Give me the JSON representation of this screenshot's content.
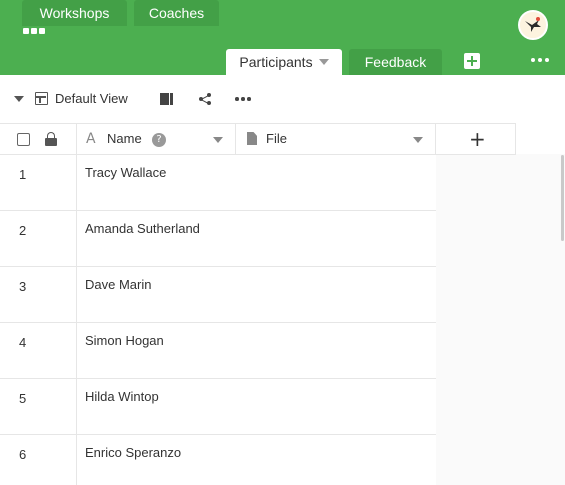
{
  "header": {
    "tabs": [
      {
        "label": "Workshops",
        "active": false
      },
      {
        "label": "Coaches",
        "active": false
      },
      {
        "label": "Participants",
        "active": true
      },
      {
        "label": "Feedback",
        "active": false
      }
    ],
    "add_tab_icon": "plus-square-icon",
    "more_icon": "more-horizontal-icon",
    "apps_icon": "apps-grid-icon",
    "avatar_icon": "user-avatar-icon"
  },
  "toolbar": {
    "view_name": "Default View",
    "view_icon": "table-icon",
    "column_icon": "columns-icon",
    "share_icon": "share-icon",
    "more_icon": "more-horizontal-icon"
  },
  "grid": {
    "columns": [
      {
        "label": "Name",
        "type_icon": "text-type-icon",
        "help": "?"
      },
      {
        "label": "File",
        "type_icon": "file-icon"
      }
    ],
    "add_column_label": "+",
    "rows": [
      {
        "num": "1",
        "name": "Tracy Wallace"
      },
      {
        "num": "2",
        "name": "Amanda Sutherland"
      },
      {
        "num": "3",
        "name": "Dave Marin"
      },
      {
        "num": "4",
        "name": "Simon Hogan"
      },
      {
        "num": "5",
        "name": "Hilda Wintop"
      },
      {
        "num": "6",
        "name": "Enrico Speranzo"
      }
    ]
  },
  "colors": {
    "brand_green": "#4caf50",
    "tab_green": "#43a047",
    "border": "#e6e6e6"
  }
}
